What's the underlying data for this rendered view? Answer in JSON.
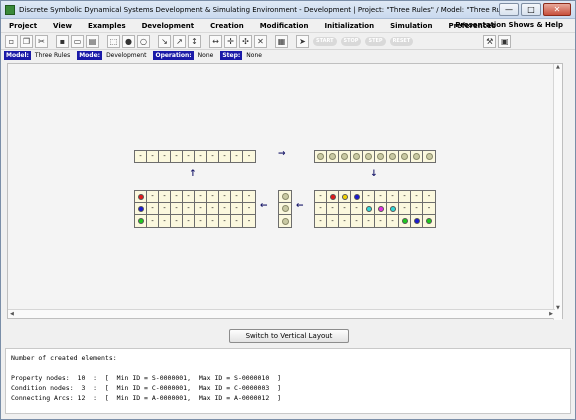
{
  "window": {
    "title": "Discrete Symbolic Dynamical Systems Development & Simulating Environment - Development  |  Project: \"Three Rules\" / Model: \"Three Rules\"",
    "minimize": "—",
    "maximize": "□",
    "close": "✕"
  },
  "menu": {
    "items": [
      "Project",
      "View",
      "Examples",
      "Development",
      "Creation",
      "Modification",
      "Initialization",
      "Simulation",
      "Preferences"
    ],
    "right": "Presentation Shows & Help"
  },
  "toolbar": {
    "icons": [
      "new-icon",
      "copy-icon",
      "cut-icon",
      "save-icon",
      "open-icon",
      "print-icon",
      "select-icon",
      "property-node-icon",
      "condition-node-icon",
      "arc-icon",
      "arc-2-icon",
      "arc-3-icon",
      "move-h-icon",
      "move-v-icon",
      "move-all-icon",
      "delete-icon",
      "table-icon",
      "pointer-icon"
    ],
    "sim_buttons": [
      "START",
      "STOP",
      "STEP",
      "RESET"
    ],
    "right_icons": [
      "tools-icon",
      "book-icon"
    ]
  },
  "status": {
    "model_label": "Model:",
    "model_value": "Three Rules",
    "mode_label": "Mode:",
    "mode_value": "Development",
    "operation_label": "Operation:",
    "operation_value": "None",
    "step_label": "Step:",
    "step_value": "None"
  },
  "canvas": {
    "top_left_row": [
      "-",
      "-",
      "-",
      "-",
      "-",
      "-",
      "-",
      "-",
      "-",
      "-"
    ],
    "top_right_row": [
      "g",
      "g",
      "g",
      "g",
      "g",
      "g",
      "g",
      "g",
      "g",
      "g"
    ],
    "bottom_left": [
      [
        "red",
        "-",
        "-",
        "-",
        "-",
        "-",
        "-",
        "-",
        "-",
        "-"
      ],
      [
        "blue",
        "-",
        "-",
        "-",
        "-",
        "-",
        "-",
        "-",
        "-",
        "-"
      ],
      [
        "green",
        "-",
        "-",
        "-",
        "-",
        "-",
        "-",
        "-",
        "-",
        "-"
      ]
    ],
    "middle_column": [
      "g",
      "g",
      "g"
    ],
    "bottom_right": [
      [
        "-",
        "red",
        "yellow",
        "blue",
        "-",
        "-",
        "-",
        "-",
        "-",
        "-"
      ],
      [
        "-",
        "-",
        "-",
        "-",
        "cyan",
        "magenta",
        "cyan",
        "-",
        "-",
        "-"
      ],
      [
        "-",
        "-",
        "-",
        "-",
        "-",
        "-",
        "-",
        "green",
        "blue",
        "green"
      ]
    ],
    "colors": {
      "red": "#e01a1a",
      "blue": "#1a1ad0",
      "green": "#1ec81e",
      "yellow": "#f0d000",
      "cyan": "#31d6d6",
      "magenta": "#e030e0",
      "g": "#c9c9a3"
    },
    "arrows": {
      "right": "→",
      "down": "↓",
      "left": "←",
      "up": "↑"
    }
  },
  "switch_button": "Switch to Vertical Layout",
  "console": {
    "heading": "Number of created elements:",
    "lines": [
      "Property nodes:  10  :  [  Min ID = S-0000001,  Max ID = S-0000010  ]",
      "Condition nodes:  3  :  [  Min ID = C-0000001,  Max ID = C-0000003  ]",
      "Connecting Arcs: 12  :  [  Min ID = A-0000001,  Max ID = A-0000012  ]"
    ]
  }
}
